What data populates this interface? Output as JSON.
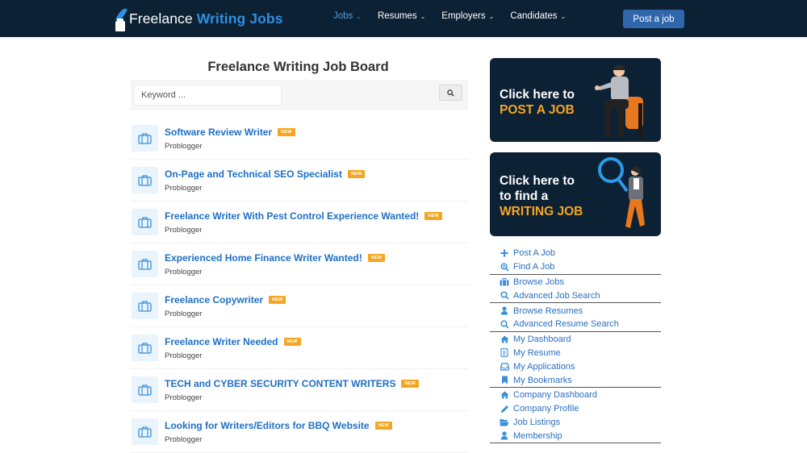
{
  "header": {
    "logo_text_plain": "Freelance",
    "logo_text_accent": "Writing Jobs",
    "nav": [
      {
        "label": "Jobs",
        "active": true
      },
      {
        "label": "Resumes",
        "active": false
      },
      {
        "label": "Employers",
        "active": false
      },
      {
        "label": "Candidates",
        "active": false
      }
    ],
    "post_job_label": "Post a job"
  },
  "main": {
    "title": "Freelance Writing Job Board",
    "search": {
      "placeholder": "Keyword ...",
      "value": ""
    },
    "new_badge": "NEW",
    "jobs": [
      {
        "title": "Software Review Writer",
        "company": "Problogger",
        "is_new": true
      },
      {
        "title": "On-Page and Technical SEO Specialist",
        "company": "Problogger",
        "is_new": true
      },
      {
        "title": "Freelance Writer With Pest Control Experience Wanted!",
        "company": "Problogger",
        "is_new": true
      },
      {
        "title": "Experienced Home Finance Writer Wanted!",
        "company": "Problogger",
        "is_new": true
      },
      {
        "title": "Freelance Copywriter",
        "company": "Problogger",
        "is_new": true
      },
      {
        "title": "Freelance Writer Needed",
        "company": "Problogger",
        "is_new": true
      },
      {
        "title": "TECH and CYBER SECURITY CONTENT WRITERS",
        "company": "Problogger",
        "is_new": true
      },
      {
        "title": "Looking for Writers/Editors for BBQ Website",
        "company": "Problogger",
        "is_new": true
      }
    ]
  },
  "sidebar": {
    "promo_post": {
      "line1": "Click here to",
      "highlight": "POST A JOB"
    },
    "promo_find": {
      "line1": "Click here to",
      "line2": "to find a",
      "highlight": "WRITING JOB"
    },
    "link_groups": [
      [
        {
          "label": "Post A Job",
          "icon": "plus-icon"
        },
        {
          "label": "Find A Job",
          "icon": "search-plus-icon"
        }
      ],
      [
        {
          "label": "Browse Jobs",
          "icon": "briefcase-icon"
        },
        {
          "label": "Advanced Job Search",
          "icon": "search-icon"
        }
      ],
      [
        {
          "label": "Browse Resumes",
          "icon": "user-icon"
        },
        {
          "label": "Advanced Resume Search",
          "icon": "search-icon"
        }
      ],
      [
        {
          "label": "My Dashboard",
          "icon": "home-icon"
        },
        {
          "label": "My Resume",
          "icon": "document-icon"
        },
        {
          "label": "My Applications",
          "icon": "inbox-icon"
        },
        {
          "label": "My Bookmarks",
          "icon": "bookmark-icon"
        }
      ],
      [
        {
          "label": "Company Dashboard",
          "icon": "home-icon"
        },
        {
          "label": "Company Profile",
          "icon": "pencil-icon"
        },
        {
          "label": "Job Listings",
          "icon": "folder-open-icon"
        },
        {
          "label": "Membership",
          "icon": "user-icon"
        }
      ]
    ]
  },
  "colors": {
    "header_bg": "#0d2135",
    "brand_blue": "#2f8fe0",
    "link_blue": "#1e6fc4",
    "button_blue": "#2f66ac",
    "badge_orange": "#f4a623"
  }
}
